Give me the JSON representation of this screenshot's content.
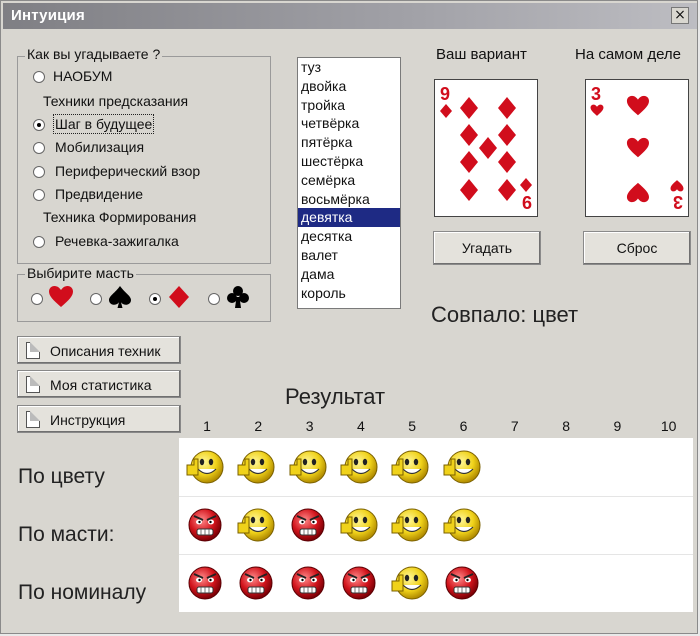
{
  "window": {
    "title": "Интуиция",
    "close_glyph": "×"
  },
  "guess_group": {
    "label": "Как вы угадываете ?",
    "options": [
      {
        "label": "НАОБУМ",
        "selected": false
      },
      {
        "header": "Техники предсказания"
      },
      {
        "label": "Шаг в будущее",
        "selected": true
      },
      {
        "label": "Мобилизация",
        "selected": false
      },
      {
        "label": "Периферический взор",
        "selected": false
      },
      {
        "label": "Предвидение",
        "selected": false
      },
      {
        "header": "Техника Формирования"
      },
      {
        "label": "Речевка-зажигалка",
        "selected": false
      }
    ]
  },
  "suit_group": {
    "label": "Выбирите масть",
    "suits": [
      {
        "icon": "heart-icon",
        "color": "#d10d1c",
        "selected": false
      },
      {
        "icon": "spade-icon",
        "color": "#000000",
        "selected": false
      },
      {
        "icon": "diamond-icon",
        "color": "#d10d1c",
        "selected": true
      },
      {
        "icon": "club-icon",
        "color": "#000000",
        "selected": false
      }
    ]
  },
  "rank_list": {
    "items": [
      "туз",
      "двойка",
      "тройка",
      "четвёрка",
      "пятёрка",
      "шестёрка",
      "семёрка",
      "восьмёрка",
      "девятка",
      "десятка",
      "валет",
      "дама",
      "король"
    ],
    "selected": "девятка"
  },
  "your_card": {
    "label": "Ваш вариант",
    "rank": "9",
    "suit": "diamond",
    "color": "#d10d1c"
  },
  "actual_card": {
    "label": "На самом деле",
    "rank": "3",
    "suit": "heart",
    "color": "#d10d1c"
  },
  "buttons": {
    "guess": "Угадать",
    "reset": "Сброс"
  },
  "match_text": "Совпало: цвет",
  "side_buttons": [
    "Описания техник",
    "Моя статистика",
    "Инструкция"
  ],
  "results": {
    "title": "Результат",
    "columns": [
      "1",
      "2",
      "3",
      "4",
      "5",
      "6",
      "7",
      "8",
      "9",
      "10"
    ],
    "rows": [
      {
        "label": "По цвету",
        "faces": [
          "happy",
          "happy",
          "happy",
          "happy",
          "happy",
          "happy"
        ]
      },
      {
        "label": "По масти:",
        "faces": [
          "angry",
          "happy",
          "angry",
          "happy",
          "happy",
          "happy"
        ]
      },
      {
        "label": "По номиналу",
        "faces": [
          "angry",
          "angry",
          "angry",
          "angry",
          "happy",
          "angry"
        ]
      }
    ]
  }
}
